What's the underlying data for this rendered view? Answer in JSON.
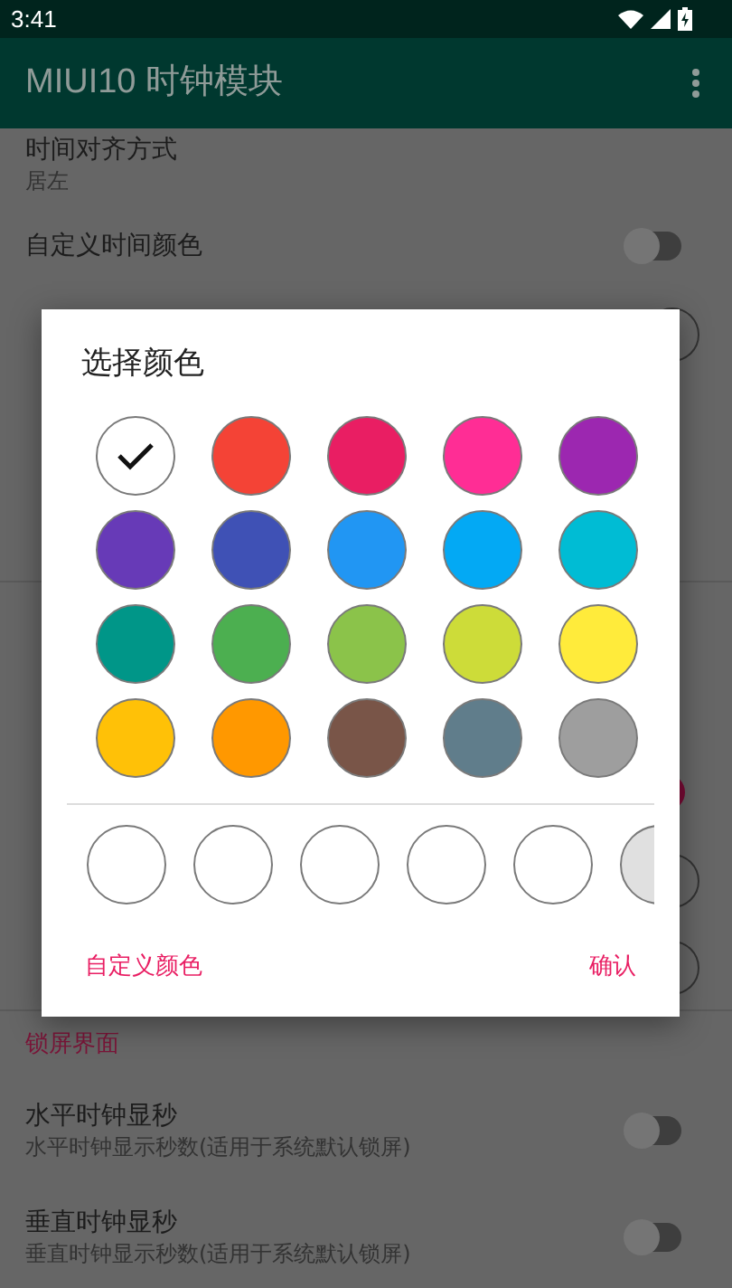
{
  "status_bar": {
    "time": "3:41"
  },
  "app_bar": {
    "title": "MIUI10 时钟模块"
  },
  "top_rows": [
    {
      "kind": "text",
      "title": "时间对齐方式",
      "subtitle": "居左"
    },
    {
      "kind": "switch",
      "title": "自定义时间颜色",
      "on": false
    }
  ],
  "covered_widgets": [
    {
      "kind": "circle"
    },
    {
      "kind": "switch",
      "on": true
    },
    {
      "kind": "circle"
    },
    {
      "kind": "circle"
    }
  ],
  "lock_screen": {
    "header": "锁屏界面",
    "rows": [
      {
        "kind": "switch",
        "title": "水平时钟显秒",
        "subtitle": "水平时钟显示秒数(适用于系统默认锁屏)",
        "on": false
      },
      {
        "kind": "switch",
        "title": "垂直时钟显秒",
        "subtitle": "垂直时钟显示秒数(适用于系统默认锁屏)",
        "on": false
      }
    ]
  },
  "dialog": {
    "title": "选择颜色",
    "colors": [
      {
        "color": "#ffffff",
        "selected": true
      },
      {
        "color": "#f44336",
        "selected": false
      },
      {
        "color": "#e91e63",
        "selected": false
      },
      {
        "color": "#ff2d95",
        "selected": false
      },
      {
        "color": "#9c27b0",
        "selected": false
      },
      {
        "color": "#673ab7",
        "selected": false
      },
      {
        "color": "#3f51b5",
        "selected": false
      },
      {
        "color": "#2196f3",
        "selected": false
      },
      {
        "color": "#03a9f4",
        "selected": false
      },
      {
        "color": "#00bcd4",
        "selected": false
      },
      {
        "color": "#009688",
        "selected": false
      },
      {
        "color": "#4caf50",
        "selected": false
      },
      {
        "color": "#8bc34a",
        "selected": false
      },
      {
        "color": "#cddc39",
        "selected": false
      },
      {
        "color": "#ffeb3b",
        "selected": false
      },
      {
        "color": "#ffc107",
        "selected": false
      },
      {
        "color": "#ff9800",
        "selected": false
      },
      {
        "color": "#795548",
        "selected": false
      },
      {
        "color": "#607d8b",
        "selected": false
      },
      {
        "color": "#9e9e9e",
        "selected": false
      }
    ],
    "custom_colors": [
      {
        "color": "#ffffff"
      },
      {
        "color": "#ffffff"
      },
      {
        "color": "#ffffff"
      },
      {
        "color": "#ffffff"
      },
      {
        "color": "#ffffff"
      },
      {
        "color": "#e0e0e0"
      }
    ],
    "buttons": [
      "自定义颜色",
      "确认"
    ]
  }
}
